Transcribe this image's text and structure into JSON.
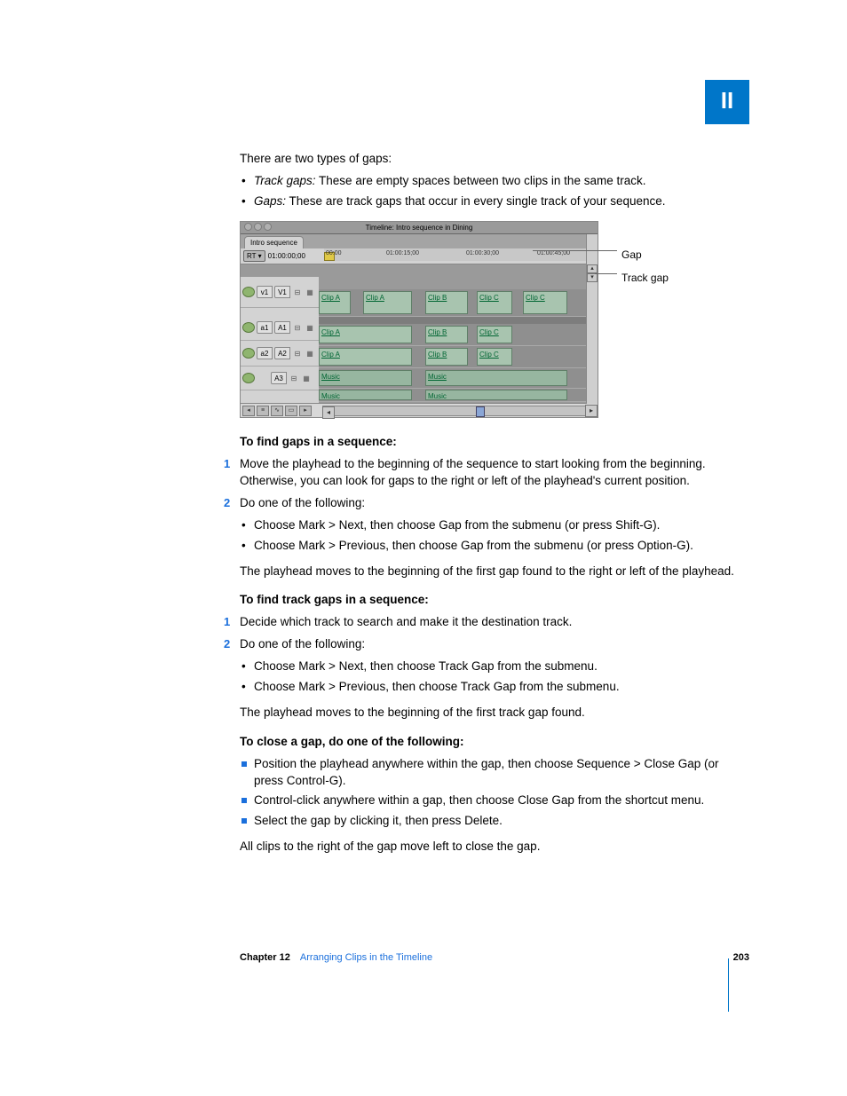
{
  "partLabel": "II",
  "intro": "There are two types of gaps:",
  "gapTypes": [
    {
      "term": "Track gaps:",
      "desc": "These are empty spaces between two clips in the same track."
    },
    {
      "term": "Gaps:",
      "desc": "These are track gaps that occur in every single track of your sequence."
    }
  ],
  "figure": {
    "windowTitle": "Timeline: Intro sequence in Dining",
    "tabName": "Intro sequence",
    "rt": "RT ▾",
    "timecode": "01:00:00;00",
    "ruler": [
      "00:00",
      "01:00:15;00",
      "01:00:30;00",
      "01:00:45;00"
    ],
    "tracks": {
      "v1": {
        "src": "v1",
        "dst": "V1"
      },
      "a1": {
        "src": "a1",
        "dst": "A1"
      },
      "a2": {
        "src": "a2",
        "dst": "A2"
      },
      "a3": {
        "src": "",
        "dst": "A3"
      }
    },
    "clips": {
      "v1": [
        "Clip A",
        "Clip A",
        "Clip B",
        "Clip C",
        "Clip C"
      ],
      "a1": [
        "Clip A",
        "Clip B",
        "Clip C"
      ],
      "a2": [
        "Clip A",
        "Clip B",
        "Clip C"
      ],
      "a3a": [
        "Music",
        "Music"
      ],
      "a3b": [
        "Music",
        "Music"
      ]
    },
    "calloutGap": "Gap",
    "calloutTrackGap": "Track gap"
  },
  "sec1": {
    "heading": "To find gaps in a sequence:",
    "step1": "Move the playhead to the beginning of the sequence to start looking from the beginning. Otherwise, you can look for gaps to the right or left of the playhead's current position.",
    "step2": "Do one of the following:",
    "step2a": "Choose Mark > Next, then choose Gap from the submenu (or press Shift-G).",
    "step2b": "Choose Mark > Previous, then choose Gap from the submenu (or press Option-G).",
    "result": "The playhead moves to the beginning of the first gap found to the right or left of the playhead."
  },
  "sec2": {
    "heading": "To find track gaps in a sequence:",
    "step1": "Decide which track to search and make it the destination track.",
    "step2": "Do one of the following:",
    "step2a": "Choose Mark > Next, then choose Track Gap from the submenu.",
    "step2b": "Choose Mark > Previous, then choose Track Gap from the submenu.",
    "result": "The playhead moves to the beginning of the first track gap found."
  },
  "sec3": {
    "heading": "To close a gap, do one of the following:",
    "b1": "Position the playhead anywhere within the gap, then choose Sequence > Close Gap (or press Control-G).",
    "b2": "Control-click anywhere within a gap, then choose Close Gap from the shortcut menu.",
    "b3": "Select the gap by clicking it, then press Delete.",
    "result": "All clips to the right of the gap move left to close the gap."
  },
  "footer": {
    "chapter": "Chapter 12",
    "title": "Arranging Clips in the Timeline",
    "page": "203"
  }
}
